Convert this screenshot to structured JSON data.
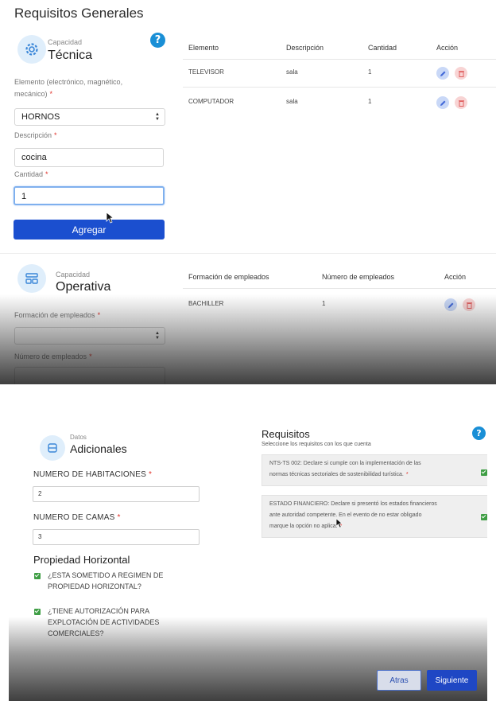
{
  "panel1": {
    "title": "Requisitos Generales",
    "tecnica": {
      "small_label": "Capacidad",
      "big_label": "Técnica",
      "help": "?",
      "element_label_line1": "Elemento (electrónico, magnético,",
      "element_label_line2": "mecánico)",
      "element_value": "HORNOS",
      "description_label": "Descripción",
      "description_value": "cocina",
      "quantity_label": "Cantidad",
      "quantity_value": "1",
      "add_button": "Agregar",
      "required_mark": "*"
    },
    "tecnica_table": {
      "headers": [
        "Elemento",
        "Descripción",
        "Cantidad",
        "Acción"
      ],
      "rows": [
        {
          "elemento": "TELEVISOR",
          "descripcion": "sala",
          "cantidad": "1"
        },
        {
          "elemento": "COMPUTADOR",
          "descripcion": "sala",
          "cantidad": "1"
        }
      ]
    },
    "operativa": {
      "small_label": "Capacidad",
      "big_label": "Operativa",
      "training_label": "Formación de empleados",
      "training_value": "",
      "employees_label": "Número de empleados",
      "required_mark": "*"
    },
    "operativa_table": {
      "headers": [
        "Formación de empleados",
        "Número de empleados",
        "Acción"
      ],
      "rows": [
        {
          "formacion": "BACHILLER",
          "numero": "1"
        }
      ]
    }
  },
  "panel2": {
    "datos": {
      "small_label": "Datos",
      "big_label": "Adicionales",
      "rooms_label": "NUMERO DE HABITACIONES",
      "rooms_value": "2",
      "beds_label": "NUMERO DE CAMAS",
      "beds_value": "3",
      "required_mark": "*"
    },
    "propiedad": {
      "title": "Propiedad Horizontal",
      "check1_line1": "¿ESTA SOMETIDO A REGIMEN DE",
      "check1_line2": "PROPIEDAD HORIZONTAL?",
      "check2_line1": "¿TIENE AUTORIZACIÓN PARA",
      "check2_line2": "EXPLOTACIÓN DE ACTIVIDADES",
      "check2_line3": "COMERCIALES?"
    },
    "requisitos": {
      "title": "Requisitos",
      "subtitle": "Seleccione los requisitos con los que cuenta",
      "help": "?",
      "item1_line1": "NTS-TS 002: Declare si cumple con la implementación de las",
      "item1_line2": "normas técnicas sectoriales de sostenibilidad turística.",
      "item2_line1": "ESTADO FINANCIERO: Declare si presentó los estados financieros",
      "item2_line2": "ante autoridad competente. En el evento de no estar obligado",
      "item2_line3": "marque la opción no aplica.",
      "required_mark": "*"
    },
    "buttons": {
      "back": "Atras",
      "next": "Siguiente"
    }
  },
  "colors": {
    "primary": "#1b4fcf",
    "help": "#1a8fd6",
    "required": "#e0322a",
    "check": "#3f9e45"
  }
}
